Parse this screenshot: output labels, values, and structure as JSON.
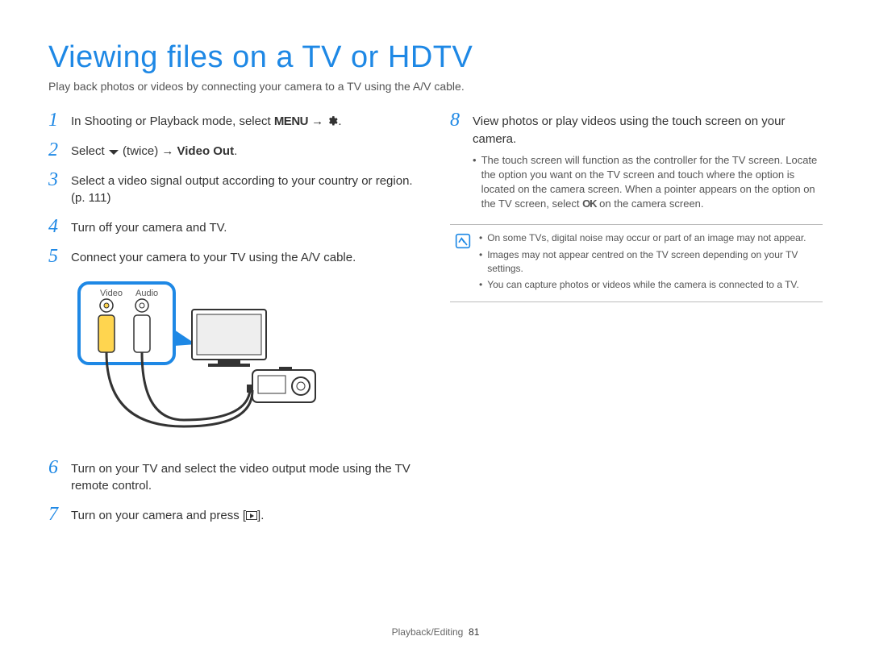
{
  "title": "Viewing files on a TV or HDTV",
  "intro": "Play back photos or videos by connecting your camera to a TV using the A/V cable.",
  "left_steps": [
    {
      "num": "1",
      "text_before": "In Shooting or Playback mode, select ",
      "menu_label": "MENU",
      "arrow": " → ",
      "gear": true,
      "text_after": "."
    },
    {
      "num": "2",
      "text_before": "Select ",
      "chevron": true,
      "text_mid": " (twice) → ",
      "bold": "Video Out",
      "text_after": "."
    },
    {
      "num": "3",
      "text": "Select a video signal output according to your country or region. (p. 111)"
    },
    {
      "num": "4",
      "text": "Turn off your camera and TV."
    },
    {
      "num": "5",
      "text": "Connect your camera to your TV using the A/V cable."
    }
  ],
  "diagram_labels": {
    "video": "Video",
    "audio": "Audio"
  },
  "left_steps2": [
    {
      "num": "6",
      "text": "Turn on your TV and select the video output mode using the TV remote control."
    },
    {
      "num": "7",
      "text_before": "Turn on your camera and press [",
      "playbox": true,
      "text_after": "]."
    }
  ],
  "right_step": {
    "num": "8",
    "text": "View photos or play videos using the touch screen on your camera.",
    "bullets": [
      {
        "pre": "The touch screen will function as the controller for the TV screen. Locate the option you want on the TV screen and touch where the option is located on the camera screen. When a pointer appears on the option on the TV screen, select ",
        "ok": "OK",
        "post": " on the camera screen."
      }
    ]
  },
  "notes": [
    "On some TVs, digital noise may occur or part of an image may not appear.",
    "Images may not appear centred on the TV screen depending on your TV settings.",
    "You can capture photos or videos while the camera is connected to a TV."
  ],
  "footer_section": "Playback/Editing",
  "footer_page": "81"
}
